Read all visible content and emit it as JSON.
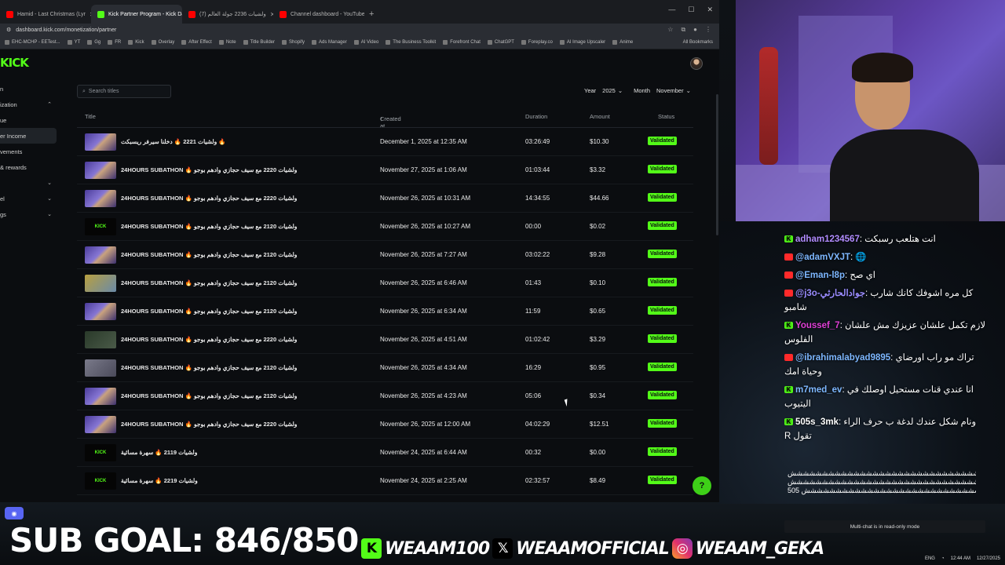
{
  "browser": {
    "tabs": [
      {
        "label": "Hamid - Last Christmas (Lyr",
        "color": "#ff0000",
        "active": false
      },
      {
        "label": "Kick Partner Program - Kick Da",
        "color": "#53fc18",
        "active": true
      },
      {
        "label": "(7) ولشيات 2236 جولة العالم",
        "color": "#ff0000",
        "active": false
      },
      {
        "label": "Channel dashboard - YouTube",
        "color": "#ff0000",
        "active": false
      }
    ],
    "new_tab": "+",
    "url": "dashboard.kick.com/monetization/partner",
    "bookmarks": [
      "EHC-MCHP - EETest...",
      "YT",
      "Gg",
      "FR",
      "Kick",
      "Overlay",
      "After Effect",
      "Note",
      "Title Builder",
      "Shopify",
      "Ads Manager",
      "AI Video",
      "The Business Toolkit",
      "Forefront Chat",
      "ChatGPT",
      "Foreplay.co",
      "AI Image Upscaler",
      "Anime"
    ],
    "all_bookmarks": "All Bookmarks"
  },
  "kick": {
    "logo": "KICK",
    "sidebar": [
      {
        "label": "n",
        "active": false,
        "chevron": false
      },
      {
        "label": "ization",
        "active": false,
        "chevron": true
      },
      {
        "label": "ue",
        "active": false,
        "chevron": false
      },
      {
        "label": "er Income",
        "active": true,
        "chevron": false
      },
      {
        "label": "vements",
        "active": false,
        "chevron": false
      },
      {
        "label": "& rewards",
        "active": false,
        "chevron": false
      },
      {
        "label": "",
        "active": false,
        "chevron": true
      },
      {
        "label": "el",
        "active": false,
        "chevron": true
      },
      {
        "label": "gs",
        "active": false,
        "chevron": true
      }
    ],
    "search_placeholder": "Search titles",
    "year_label": "Year",
    "year_value": "2025",
    "month_label": "Month",
    "month_value": "November",
    "columns": {
      "title": "Title",
      "created": "Created at",
      "duration": "Duration",
      "amount": "Amount",
      "status": "Status"
    },
    "rows": [
      {
        "title": "ولشيات 2221 🔥 دخلنا سيرفر ريسبكت 🔥",
        "date": "December 1, 2025 at 12:35 AM",
        "duration": "03:26:49",
        "amount": "$10.30",
        "status": "Validated",
        "thumb": "stream"
      },
      {
        "title": "24HOURS SUBATHON 🔥 ولشيات 2220 مع سيف حجازي وادهم بوجو",
        "date": "November 27, 2025 at 1:06 AM",
        "duration": "01:03:44",
        "amount": "$3.32",
        "status": "Validated",
        "thumb": "stream"
      },
      {
        "title": "24HOURS SUBATHON 🔥 ولشيات 2220 مع سيف حجازي وادهم بوجو",
        "date": "November 26, 2025 at 10:31 AM",
        "duration": "14:34:55",
        "amount": "$44.66",
        "status": "Validated",
        "thumb": "stream"
      },
      {
        "title": "24HOURS SUBATHON 🔥 ولشيات 2120 مع سيف حجازي وادهم بوجو",
        "date": "November 26, 2025 at 10:27 AM",
        "duration": "00:00",
        "amount": "$0.02",
        "status": "Validated",
        "thumb": "kick"
      },
      {
        "title": "24HOURS SUBATHON 🔥 ولشيات 2120 مع سيف حجازي وادهم بوجو",
        "date": "November 26, 2025 at 7:27 AM",
        "duration": "03:02:22",
        "amount": "$9.28",
        "status": "Validated",
        "thumb": "stream"
      },
      {
        "title": "24HOURS SUBATHON 🔥 ولشيات 2120 مع سيف حجازي وادهم بوجو",
        "date": "November 26, 2025 at 6:46 AM",
        "duration": "01:43",
        "amount": "$0.10",
        "status": "Validated",
        "thumb": "yellow"
      },
      {
        "title": "24HOURS SUBATHON 🔥 ولشيات 2120 مع سيف حجازي وادهم بوجو",
        "date": "November 26, 2025 at 6:34 AM",
        "duration": "11:59",
        "amount": "$0.65",
        "status": "Validated",
        "thumb": "stream"
      },
      {
        "title": "24HOURS SUBATHON 🔥 ولشيات 2220 مع سيف حجازي وادهم بوجو",
        "date": "November 26, 2025 at 4:51 AM",
        "duration": "01:02:42",
        "amount": "$3.29",
        "status": "Validated",
        "thumb": "dark"
      },
      {
        "title": "24HOURS SUBATHON 🔥 ولشيات 2120 مع سيف حجازي وادهم بوجو",
        "date": "November 26, 2025 at 4:34 AM",
        "duration": "16:29",
        "amount": "$0.95",
        "status": "Validated",
        "thumb": "grey"
      },
      {
        "title": "24HOURS SUBATHON 🔥 ولشيات 2120 مع سيف حجازي وادهم بوجو",
        "date": "November 26, 2025 at 4:23 AM",
        "duration": "05:06",
        "amount": "$0.34",
        "status": "Validated",
        "thumb": "stream"
      },
      {
        "title": "24HOURS SUBATHON 🔥 ولشيات 2220 مع سيف حجازي وادهم بوجو",
        "date": "November 26, 2025 at 12:00 AM",
        "duration": "04:02:29",
        "amount": "$12.51",
        "status": "Validated",
        "thumb": "stream"
      },
      {
        "title": "ولشيات 2119 🔥 سهرة مسائية",
        "date": "November 24, 2025 at 6:44 AM",
        "duration": "00:32",
        "amount": "$0.00",
        "status": "Validated",
        "thumb": "kick"
      },
      {
        "title": "ولشيات 2219 🔥 سهرة مسائية",
        "date": "November 24, 2025 at 2:25 AM",
        "duration": "02:32:57",
        "amount": "$8.49",
        "status": "Validated",
        "thumb": "kick"
      }
    ],
    "help_icon": "?"
  },
  "chat": {
    "messages": [
      {
        "platform": "kick",
        "user": "adham1234567",
        "body": "انت هتلعب رسبكت",
        "color": "#b18cff"
      },
      {
        "platform": "youtube",
        "user": "@adamVXJT",
        "body": "🌐",
        "color": "#7db7ff"
      },
      {
        "platform": "youtube",
        "user": "@Eman-l8p",
        "body": "اي صح",
        "color": "#7db7ff"
      },
      {
        "platform": "youtube",
        "user": "@j3o-جوادالحارثي",
        "body": "كل مره اشوفك كانك شارب شامبو",
        "color": "#9a8cff"
      },
      {
        "platform": "kick",
        "user": "Youssef_7",
        "body": "لازم تكمل علشان عزيزك مش علشان الفلوس",
        "color": "#e03fd6"
      },
      {
        "platform": "youtube",
        "user": "@ibrahimalabyad9895",
        "body": "تراك مو راب اورضاي وحياة امك",
        "color": "#7db7ff"
      },
      {
        "platform": "kick",
        "user": "m7med_ev",
        "body": "انا عندي قنات مستحيل اوصلك في اليتيوب",
        "color": "#7db7ff"
      },
      {
        "platform": "kick",
        "user": "505s_3mk",
        "body": "ونام شكل عندك لدغة ب حرف الراء تقول R",
        "color": "#ffffff"
      }
    ],
    "spam_lines": [
      "ششششششششششششششششششششششششششششششششششششششششششششش",
      "ششششششششششششششششششششششششششششششششششششششششششششش",
      "505 شششششششششششششششششششششششششششش"
    ],
    "readonly_note": "Multi-chat is in read-only mode"
  },
  "overlay": {
    "sub_goal": "SUB GOAL: 846/850",
    "kick_handle": "WEAAM100",
    "x_handle": "WEAAMOFFICIAL",
    "ig_handle": "WEAAM_GEKA",
    "discord_label": "Discord"
  },
  "taskbar": {
    "lang": "ENG",
    "time": "12:44 AM",
    "date": "12/27/2025"
  },
  "colors": {
    "kick_green": "#53fc18",
    "youtube_red": "#ff0000"
  }
}
